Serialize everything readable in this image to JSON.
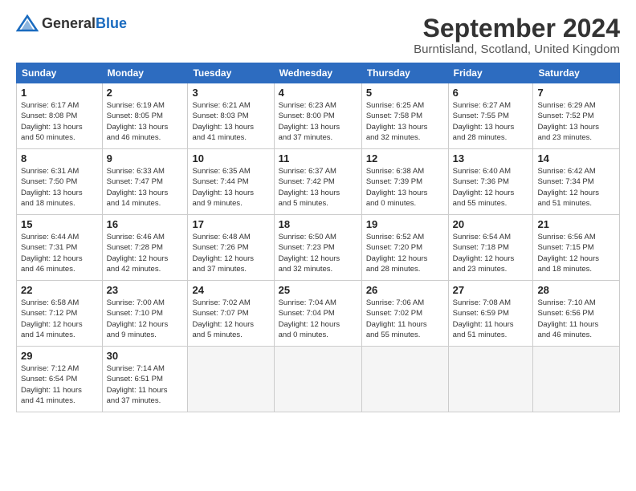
{
  "header": {
    "logo_general": "General",
    "logo_blue": "Blue",
    "title": "September 2024",
    "location": "Burntisland, Scotland, United Kingdom"
  },
  "calendar": {
    "columns": [
      "Sunday",
      "Monday",
      "Tuesday",
      "Wednesday",
      "Thursday",
      "Friday",
      "Saturday"
    ],
    "weeks": [
      [
        {
          "day": "1",
          "info": "Sunrise: 6:17 AM\nSunset: 8:08 PM\nDaylight: 13 hours\nand 50 minutes."
        },
        {
          "day": "2",
          "info": "Sunrise: 6:19 AM\nSunset: 8:05 PM\nDaylight: 13 hours\nand 46 minutes."
        },
        {
          "day": "3",
          "info": "Sunrise: 6:21 AM\nSunset: 8:03 PM\nDaylight: 13 hours\nand 41 minutes."
        },
        {
          "day": "4",
          "info": "Sunrise: 6:23 AM\nSunset: 8:00 PM\nDaylight: 13 hours\nand 37 minutes."
        },
        {
          "day": "5",
          "info": "Sunrise: 6:25 AM\nSunset: 7:58 PM\nDaylight: 13 hours\nand 32 minutes."
        },
        {
          "day": "6",
          "info": "Sunrise: 6:27 AM\nSunset: 7:55 PM\nDaylight: 13 hours\nand 28 minutes."
        },
        {
          "day": "7",
          "info": "Sunrise: 6:29 AM\nSunset: 7:52 PM\nDaylight: 13 hours\nand 23 minutes."
        }
      ],
      [
        {
          "day": "8",
          "info": "Sunrise: 6:31 AM\nSunset: 7:50 PM\nDaylight: 13 hours\nand 18 minutes."
        },
        {
          "day": "9",
          "info": "Sunrise: 6:33 AM\nSunset: 7:47 PM\nDaylight: 13 hours\nand 14 minutes."
        },
        {
          "day": "10",
          "info": "Sunrise: 6:35 AM\nSunset: 7:44 PM\nDaylight: 13 hours\nand 9 minutes."
        },
        {
          "day": "11",
          "info": "Sunrise: 6:37 AM\nSunset: 7:42 PM\nDaylight: 13 hours\nand 5 minutes."
        },
        {
          "day": "12",
          "info": "Sunrise: 6:38 AM\nSunset: 7:39 PM\nDaylight: 13 hours\nand 0 minutes."
        },
        {
          "day": "13",
          "info": "Sunrise: 6:40 AM\nSunset: 7:36 PM\nDaylight: 12 hours\nand 55 minutes."
        },
        {
          "day": "14",
          "info": "Sunrise: 6:42 AM\nSunset: 7:34 PM\nDaylight: 12 hours\nand 51 minutes."
        }
      ],
      [
        {
          "day": "15",
          "info": "Sunrise: 6:44 AM\nSunset: 7:31 PM\nDaylight: 12 hours\nand 46 minutes."
        },
        {
          "day": "16",
          "info": "Sunrise: 6:46 AM\nSunset: 7:28 PM\nDaylight: 12 hours\nand 42 minutes."
        },
        {
          "day": "17",
          "info": "Sunrise: 6:48 AM\nSunset: 7:26 PM\nDaylight: 12 hours\nand 37 minutes."
        },
        {
          "day": "18",
          "info": "Sunrise: 6:50 AM\nSunset: 7:23 PM\nDaylight: 12 hours\nand 32 minutes."
        },
        {
          "day": "19",
          "info": "Sunrise: 6:52 AM\nSunset: 7:20 PM\nDaylight: 12 hours\nand 28 minutes."
        },
        {
          "day": "20",
          "info": "Sunrise: 6:54 AM\nSunset: 7:18 PM\nDaylight: 12 hours\nand 23 minutes."
        },
        {
          "day": "21",
          "info": "Sunrise: 6:56 AM\nSunset: 7:15 PM\nDaylight: 12 hours\nand 18 minutes."
        }
      ],
      [
        {
          "day": "22",
          "info": "Sunrise: 6:58 AM\nSunset: 7:12 PM\nDaylight: 12 hours\nand 14 minutes."
        },
        {
          "day": "23",
          "info": "Sunrise: 7:00 AM\nSunset: 7:10 PM\nDaylight: 12 hours\nand 9 minutes."
        },
        {
          "day": "24",
          "info": "Sunrise: 7:02 AM\nSunset: 7:07 PM\nDaylight: 12 hours\nand 5 minutes."
        },
        {
          "day": "25",
          "info": "Sunrise: 7:04 AM\nSunset: 7:04 PM\nDaylight: 12 hours\nand 0 minutes."
        },
        {
          "day": "26",
          "info": "Sunrise: 7:06 AM\nSunset: 7:02 PM\nDaylight: 11 hours\nand 55 minutes."
        },
        {
          "day": "27",
          "info": "Sunrise: 7:08 AM\nSunset: 6:59 PM\nDaylight: 11 hours\nand 51 minutes."
        },
        {
          "day": "28",
          "info": "Sunrise: 7:10 AM\nSunset: 6:56 PM\nDaylight: 11 hours\nand 46 minutes."
        }
      ],
      [
        {
          "day": "29",
          "info": "Sunrise: 7:12 AM\nSunset: 6:54 PM\nDaylight: 11 hours\nand 41 minutes."
        },
        {
          "day": "30",
          "info": "Sunrise: 7:14 AM\nSunset: 6:51 PM\nDaylight: 11 hours\nand 37 minutes."
        },
        {
          "day": "",
          "info": ""
        },
        {
          "day": "",
          "info": ""
        },
        {
          "day": "",
          "info": ""
        },
        {
          "day": "",
          "info": ""
        },
        {
          "day": "",
          "info": ""
        }
      ]
    ]
  }
}
